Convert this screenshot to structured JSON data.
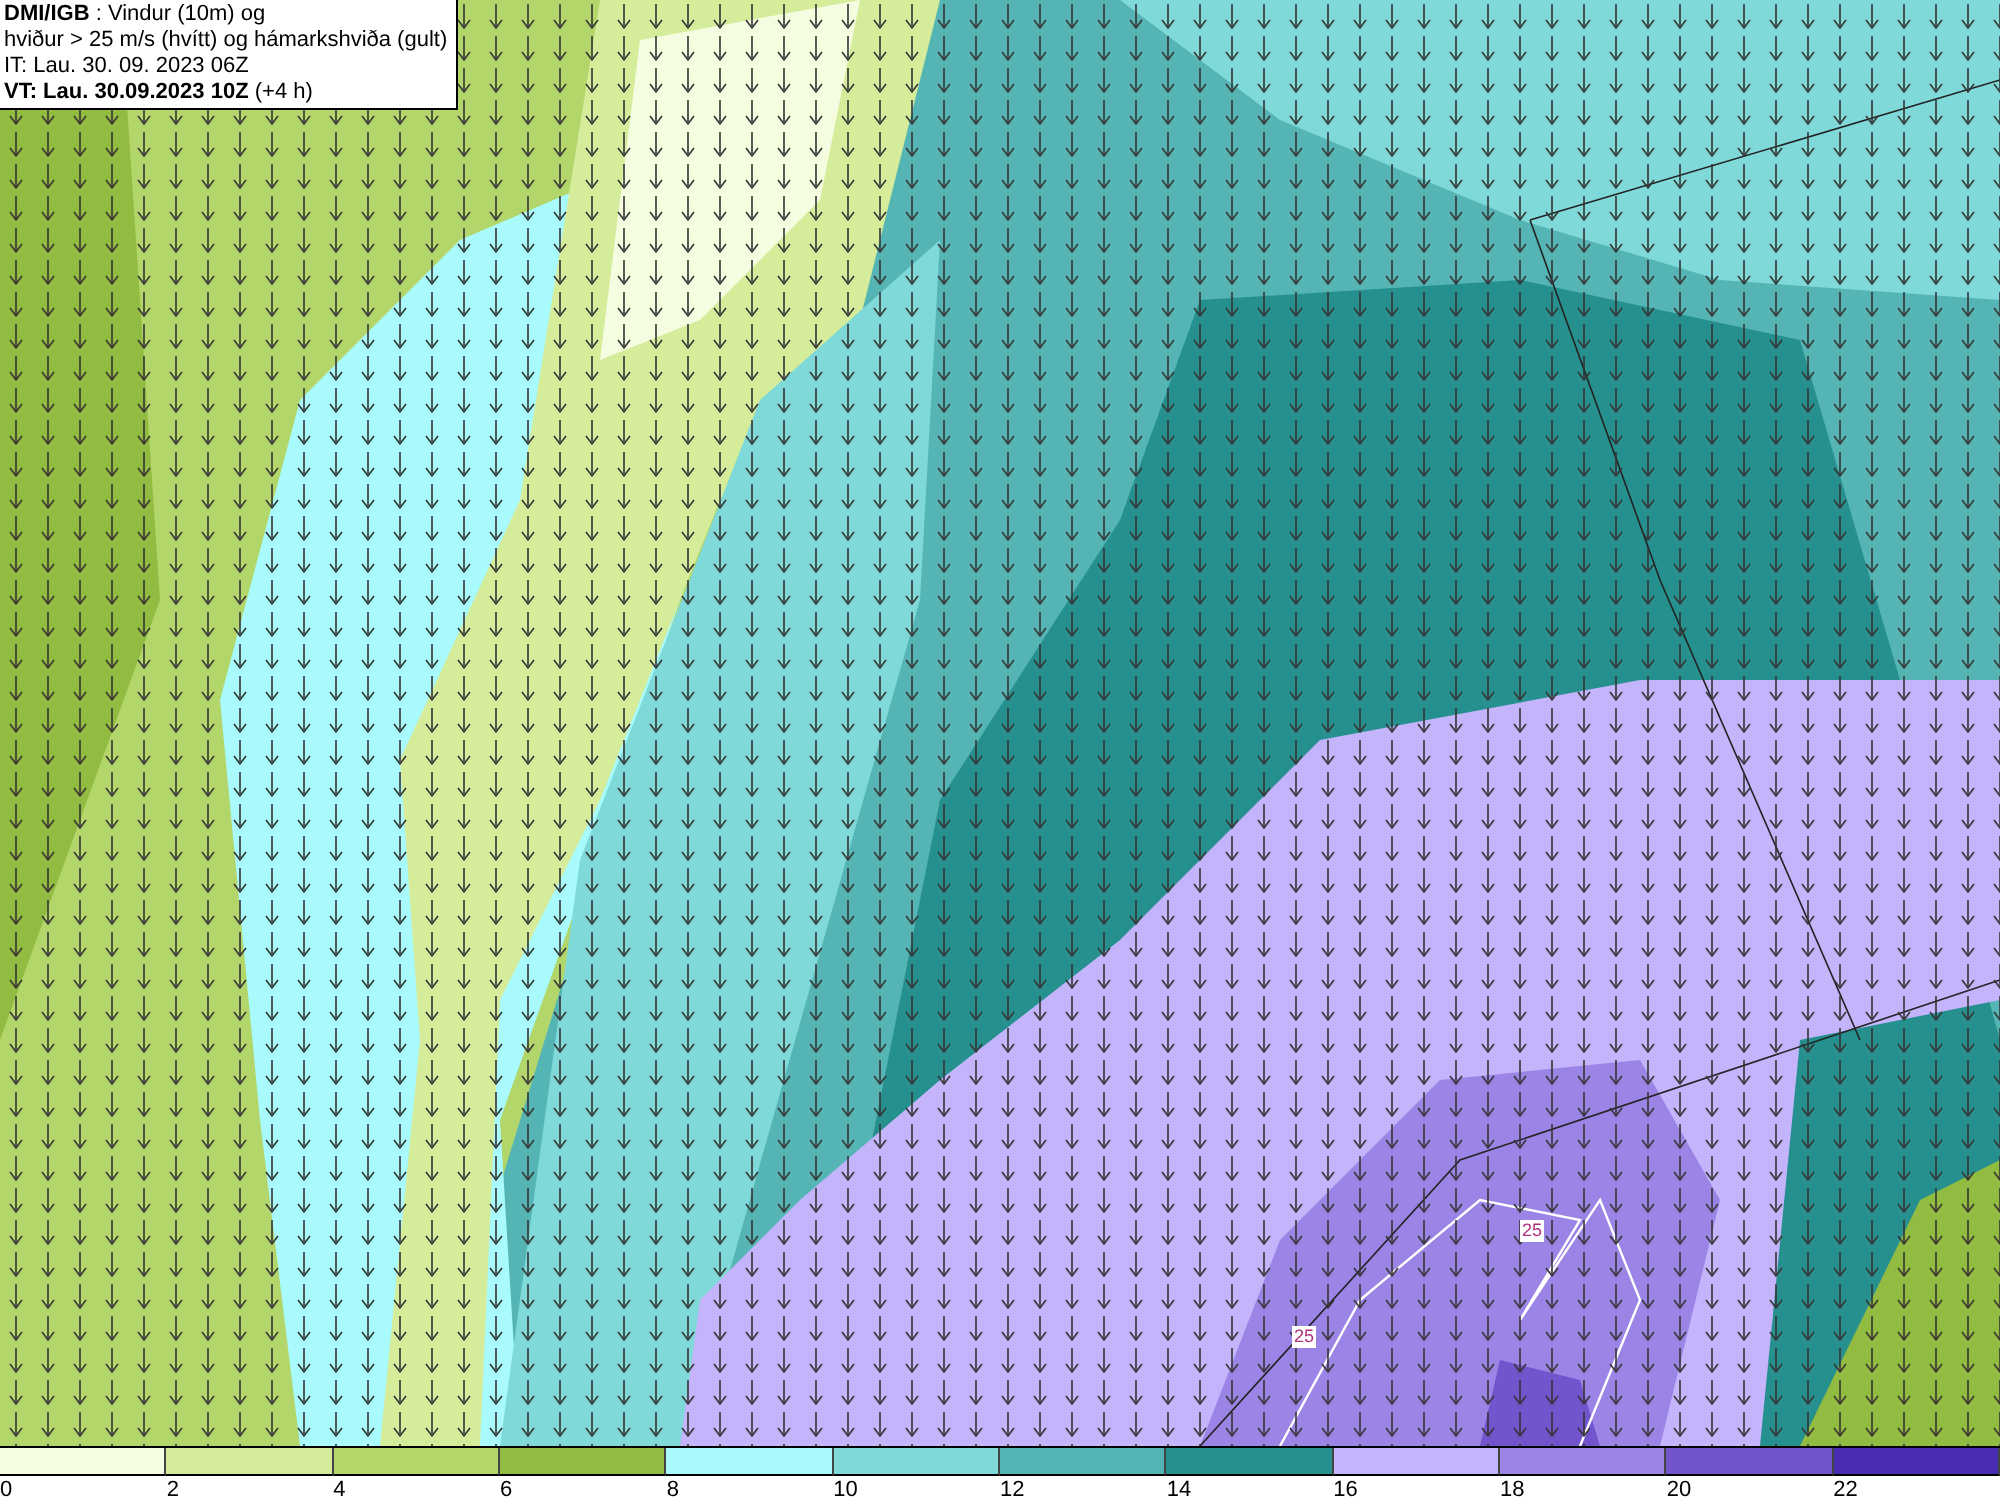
{
  "title_box": {
    "lines": [
      "**DMI/IGB** : Vindur (10m) og",
      "hviður > 25 m/s (hvítt) og hámarkshviða (gult)",
      "IT: Lau. 30. 09. 2023 06Z",
      "**VT: Lau. 30.09.2023 10Z** (+4 h)"
    ]
  },
  "map": {
    "contour_labels": [
      "25",
      "25"
    ]
  },
  "legend": [
    {
      "label": "0",
      "color": "#f5fde0"
    },
    {
      "label": "2",
      "color": "#d5ec9a"
    },
    {
      "label": "4",
      "color": "#b3d66a"
    },
    {
      "label": "6",
      "color": "#92bb42"
    },
    {
      "label": "8",
      "color": "#a8fafc"
    },
    {
      "label": "10",
      "color": "#7fd9d8"
    },
    {
      "label": "12",
      "color": "#55b5b5"
    },
    {
      "label": "14",
      "color": "#26908f"
    },
    {
      "label": "16",
      "color": "#c3b4fb"
    },
    {
      "label": "18",
      "color": "#9b84e6"
    },
    {
      "label": "20",
      "color": "#7254cd"
    },
    {
      "label": "22",
      "color": "#4a2cb0"
    }
  ]
}
